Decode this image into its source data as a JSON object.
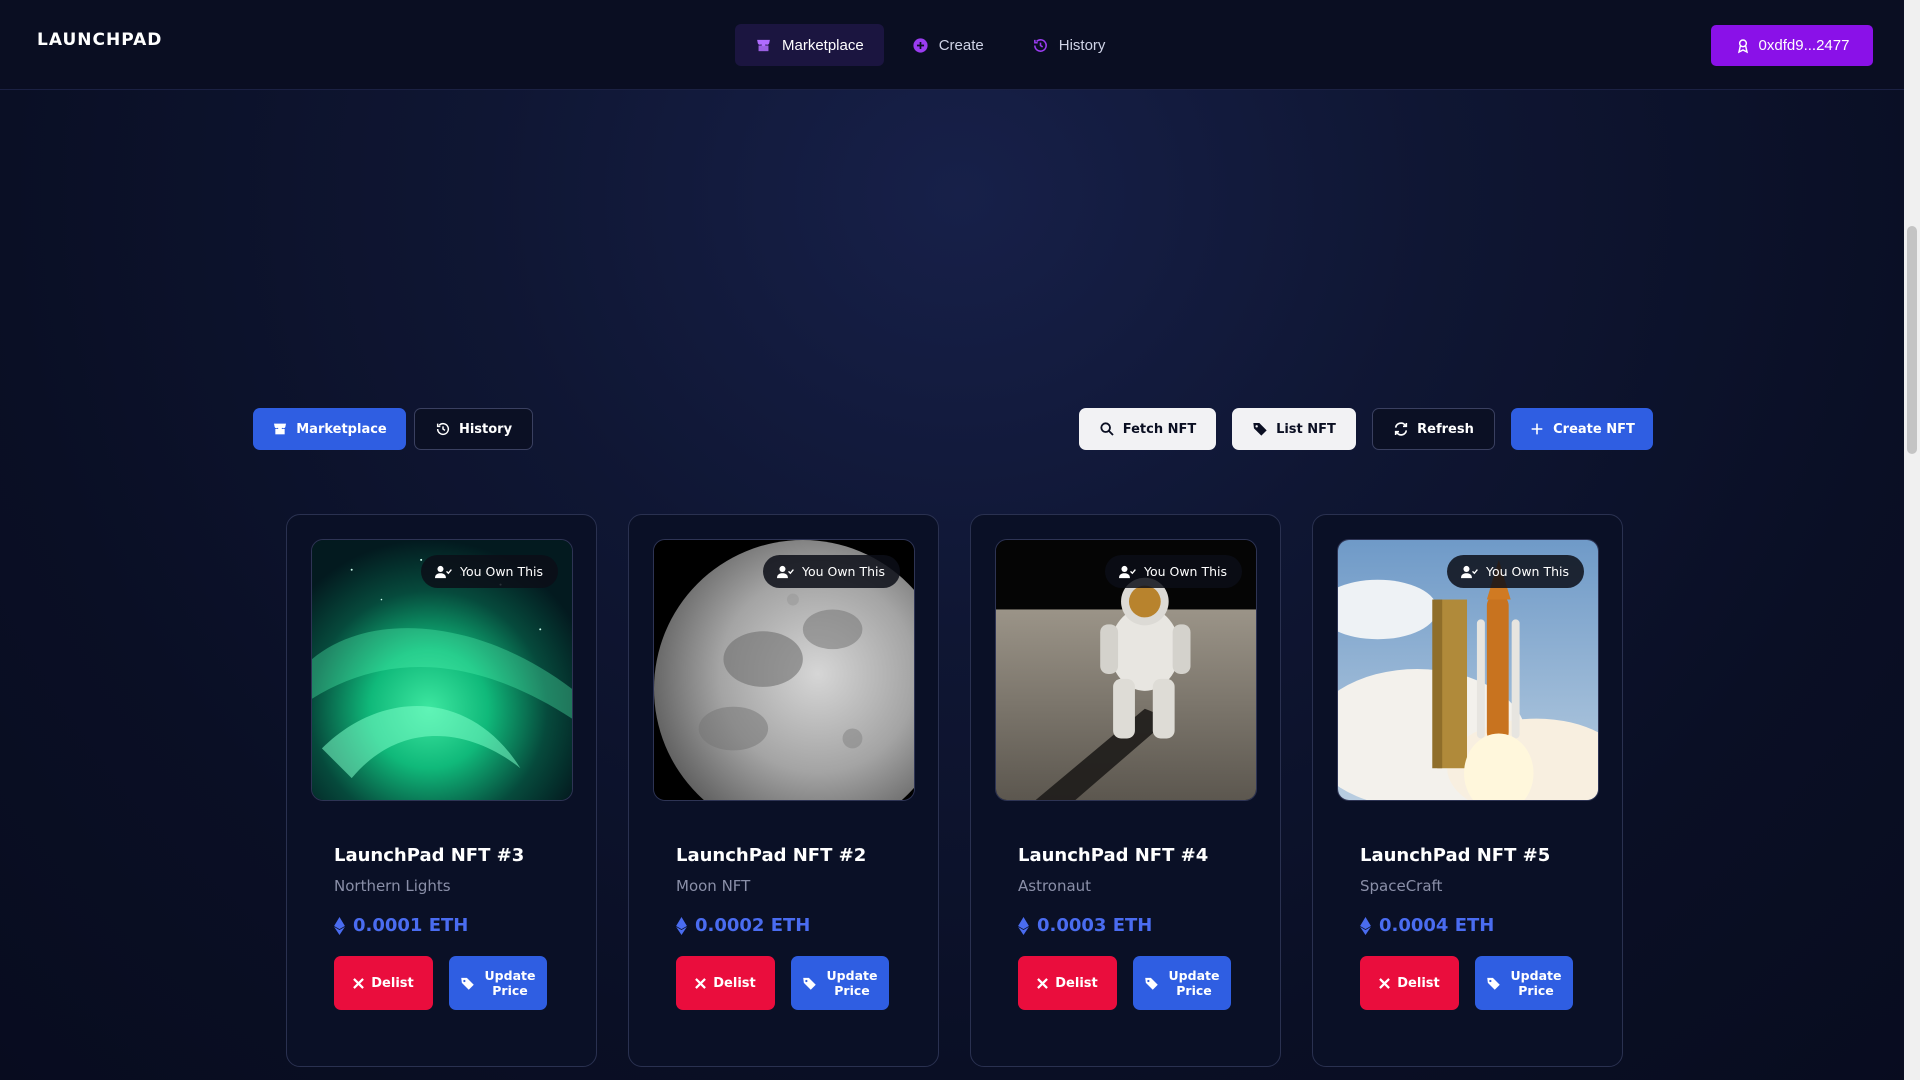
{
  "app": {
    "logo_text": "LAUNCHPAD"
  },
  "nav": {
    "items": [
      {
        "label": "Marketplace",
        "icon": "store-icon",
        "active": true
      },
      {
        "label": "Create",
        "icon": "plus-circle-icon",
        "active": false
      },
      {
        "label": "History",
        "icon": "history-icon",
        "active": false
      }
    ],
    "wallet_label": "0xdfd9...2477"
  },
  "toolbar": {
    "marketplace_label": "Marketplace",
    "history_label": "History",
    "fetch_label": "Fetch NFT",
    "list_label": "List NFT",
    "refresh_label": "Refresh",
    "create_label": "Create NFT"
  },
  "cards": [
    {
      "badge": "You Own This",
      "title": "LaunchPad NFT #3",
      "subtitle": "Northern Lights",
      "price": "0.0001 ETH",
      "image": "northern-lights",
      "delist_label": "Delist",
      "update_label": "Update Price"
    },
    {
      "badge": "You Own This",
      "title": "LaunchPad NFT #2",
      "subtitle": "Moon NFT",
      "price": "0.0002 ETH",
      "image": "moon",
      "delist_label": "Delist",
      "update_label": "Update Price"
    },
    {
      "badge": "You Own This",
      "title": "LaunchPad NFT #4",
      "subtitle": "Astronaut",
      "price": "0.0003 ETH",
      "image": "astronaut",
      "delist_label": "Delist",
      "update_label": "Update Price"
    },
    {
      "badge": "You Own This",
      "title": "LaunchPad NFT #5",
      "subtitle": "SpaceCraft",
      "price": "0.0004 ETH",
      "image": "spacecraft",
      "delist_label": "Delist",
      "update_label": "Update Price"
    }
  ],
  "colors": {
    "accent_purple": "#8a11e8",
    "accent_blue": "#2f5ee2",
    "danger_red": "#ea0d3d",
    "price_blue": "#4a6cf0",
    "background": "#0a0f25"
  }
}
